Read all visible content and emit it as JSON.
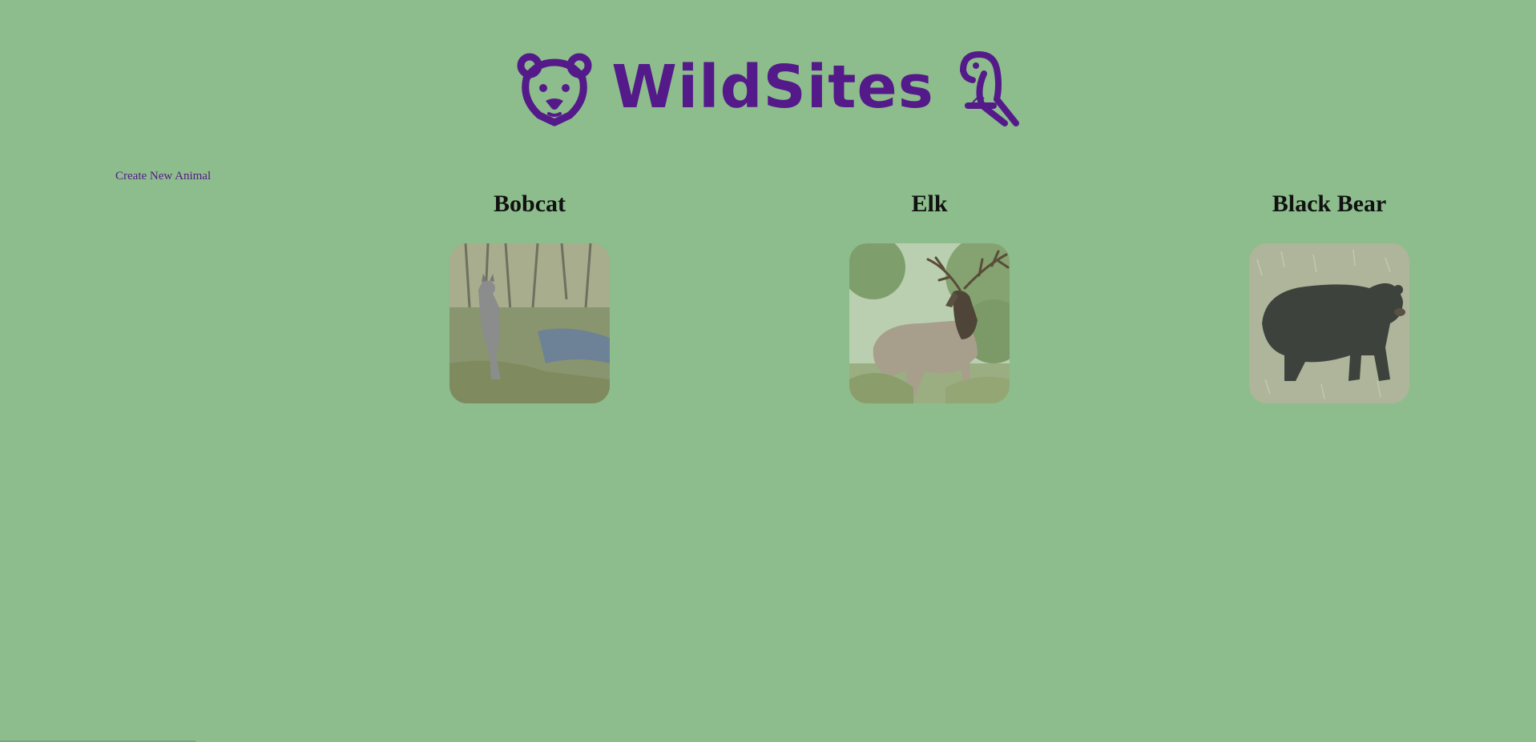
{
  "header": {
    "brand": "WildSites",
    "logo_left_icon": "bear-face-icon",
    "logo_right_icon": "parrot-icon",
    "brand_color": "#541a8a"
  },
  "actions": {
    "create_label": "Create New Animal"
  },
  "animals": [
    {
      "name": "Bobcat",
      "photo": "bobcat-photo"
    },
    {
      "name": "Elk",
      "photo": "elk-photo"
    },
    {
      "name": "Black Bear",
      "photo": "black-bear-photo"
    }
  ],
  "colors": {
    "background": "#8dbd8c",
    "text": "#111111"
  }
}
